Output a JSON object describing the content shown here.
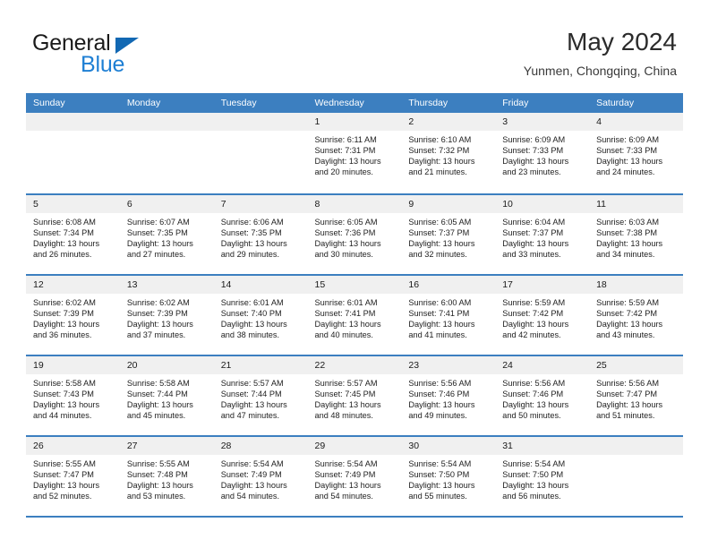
{
  "brand": {
    "name_part1": "General",
    "name_part2": "Blue",
    "triangle_color": "#1268b3",
    "blue_color": "#1e7fd4"
  },
  "header": {
    "month_title": "May 2024",
    "location": "Yunmen, Chongqing, China"
  },
  "theme": {
    "header_row_bg": "#3c7fc0",
    "header_row_text": "#ffffff",
    "day_band_bg": "#f0f0f0",
    "cell_bg": "#ffffff",
    "separator": "#3c7fc0"
  },
  "calendar": {
    "day_headers": [
      "Sunday",
      "Monday",
      "Tuesday",
      "Wednesday",
      "Thursday",
      "Friday",
      "Saturday"
    ],
    "weeks": [
      [
        {
          "empty": true
        },
        {
          "empty": true
        },
        {
          "empty": true
        },
        {
          "day": "1",
          "sunrise": "Sunrise: 6:11 AM",
          "sunset": "Sunset: 7:31 PM",
          "daylight_1": "Daylight: 13 hours",
          "daylight_2": "and 20 minutes."
        },
        {
          "day": "2",
          "sunrise": "Sunrise: 6:10 AM",
          "sunset": "Sunset: 7:32 PM",
          "daylight_1": "Daylight: 13 hours",
          "daylight_2": "and 21 minutes."
        },
        {
          "day": "3",
          "sunrise": "Sunrise: 6:09 AM",
          "sunset": "Sunset: 7:33 PM",
          "daylight_1": "Daylight: 13 hours",
          "daylight_2": "and 23 minutes."
        },
        {
          "day": "4",
          "sunrise": "Sunrise: 6:09 AM",
          "sunset": "Sunset: 7:33 PM",
          "daylight_1": "Daylight: 13 hours",
          "daylight_2": "and 24 minutes."
        }
      ],
      [
        {
          "day": "5",
          "sunrise": "Sunrise: 6:08 AM",
          "sunset": "Sunset: 7:34 PM",
          "daylight_1": "Daylight: 13 hours",
          "daylight_2": "and 26 minutes."
        },
        {
          "day": "6",
          "sunrise": "Sunrise: 6:07 AM",
          "sunset": "Sunset: 7:35 PM",
          "daylight_1": "Daylight: 13 hours",
          "daylight_2": "and 27 minutes."
        },
        {
          "day": "7",
          "sunrise": "Sunrise: 6:06 AM",
          "sunset": "Sunset: 7:35 PM",
          "daylight_1": "Daylight: 13 hours",
          "daylight_2": "and 29 minutes."
        },
        {
          "day": "8",
          "sunrise": "Sunrise: 6:05 AM",
          "sunset": "Sunset: 7:36 PM",
          "daylight_1": "Daylight: 13 hours",
          "daylight_2": "and 30 minutes."
        },
        {
          "day": "9",
          "sunrise": "Sunrise: 6:05 AM",
          "sunset": "Sunset: 7:37 PM",
          "daylight_1": "Daylight: 13 hours",
          "daylight_2": "and 32 minutes."
        },
        {
          "day": "10",
          "sunrise": "Sunrise: 6:04 AM",
          "sunset": "Sunset: 7:37 PM",
          "daylight_1": "Daylight: 13 hours",
          "daylight_2": "and 33 minutes."
        },
        {
          "day": "11",
          "sunrise": "Sunrise: 6:03 AM",
          "sunset": "Sunset: 7:38 PM",
          "daylight_1": "Daylight: 13 hours",
          "daylight_2": "and 34 minutes."
        }
      ],
      [
        {
          "day": "12",
          "sunrise": "Sunrise: 6:02 AM",
          "sunset": "Sunset: 7:39 PM",
          "daylight_1": "Daylight: 13 hours",
          "daylight_2": "and 36 minutes."
        },
        {
          "day": "13",
          "sunrise": "Sunrise: 6:02 AM",
          "sunset": "Sunset: 7:39 PM",
          "daylight_1": "Daylight: 13 hours",
          "daylight_2": "and 37 minutes."
        },
        {
          "day": "14",
          "sunrise": "Sunrise: 6:01 AM",
          "sunset": "Sunset: 7:40 PM",
          "daylight_1": "Daylight: 13 hours",
          "daylight_2": "and 38 minutes."
        },
        {
          "day": "15",
          "sunrise": "Sunrise: 6:01 AM",
          "sunset": "Sunset: 7:41 PM",
          "daylight_1": "Daylight: 13 hours",
          "daylight_2": "and 40 minutes."
        },
        {
          "day": "16",
          "sunrise": "Sunrise: 6:00 AM",
          "sunset": "Sunset: 7:41 PM",
          "daylight_1": "Daylight: 13 hours",
          "daylight_2": "and 41 minutes."
        },
        {
          "day": "17",
          "sunrise": "Sunrise: 5:59 AM",
          "sunset": "Sunset: 7:42 PM",
          "daylight_1": "Daylight: 13 hours",
          "daylight_2": "and 42 minutes."
        },
        {
          "day": "18",
          "sunrise": "Sunrise: 5:59 AM",
          "sunset": "Sunset: 7:42 PM",
          "daylight_1": "Daylight: 13 hours",
          "daylight_2": "and 43 minutes."
        }
      ],
      [
        {
          "day": "19",
          "sunrise": "Sunrise: 5:58 AM",
          "sunset": "Sunset: 7:43 PM",
          "daylight_1": "Daylight: 13 hours",
          "daylight_2": "and 44 minutes."
        },
        {
          "day": "20",
          "sunrise": "Sunrise: 5:58 AM",
          "sunset": "Sunset: 7:44 PM",
          "daylight_1": "Daylight: 13 hours",
          "daylight_2": "and 45 minutes."
        },
        {
          "day": "21",
          "sunrise": "Sunrise: 5:57 AM",
          "sunset": "Sunset: 7:44 PM",
          "daylight_1": "Daylight: 13 hours",
          "daylight_2": "and 47 minutes."
        },
        {
          "day": "22",
          "sunrise": "Sunrise: 5:57 AM",
          "sunset": "Sunset: 7:45 PM",
          "daylight_1": "Daylight: 13 hours",
          "daylight_2": "and 48 minutes."
        },
        {
          "day": "23",
          "sunrise": "Sunrise: 5:56 AM",
          "sunset": "Sunset: 7:46 PM",
          "daylight_1": "Daylight: 13 hours",
          "daylight_2": "and 49 minutes."
        },
        {
          "day": "24",
          "sunrise": "Sunrise: 5:56 AM",
          "sunset": "Sunset: 7:46 PM",
          "daylight_1": "Daylight: 13 hours",
          "daylight_2": "and 50 minutes."
        },
        {
          "day": "25",
          "sunrise": "Sunrise: 5:56 AM",
          "sunset": "Sunset: 7:47 PM",
          "daylight_1": "Daylight: 13 hours",
          "daylight_2": "and 51 minutes."
        }
      ],
      [
        {
          "day": "26",
          "sunrise": "Sunrise: 5:55 AM",
          "sunset": "Sunset: 7:47 PM",
          "daylight_1": "Daylight: 13 hours",
          "daylight_2": "and 52 minutes."
        },
        {
          "day": "27",
          "sunrise": "Sunrise: 5:55 AM",
          "sunset": "Sunset: 7:48 PM",
          "daylight_1": "Daylight: 13 hours",
          "daylight_2": "and 53 minutes."
        },
        {
          "day": "28",
          "sunrise": "Sunrise: 5:54 AM",
          "sunset": "Sunset: 7:49 PM",
          "daylight_1": "Daylight: 13 hours",
          "daylight_2": "and 54 minutes."
        },
        {
          "day": "29",
          "sunrise": "Sunrise: 5:54 AM",
          "sunset": "Sunset: 7:49 PM",
          "daylight_1": "Daylight: 13 hours",
          "daylight_2": "and 54 minutes."
        },
        {
          "day": "30",
          "sunrise": "Sunrise: 5:54 AM",
          "sunset": "Sunset: 7:50 PM",
          "daylight_1": "Daylight: 13 hours",
          "daylight_2": "and 55 minutes."
        },
        {
          "day": "31",
          "sunrise": "Sunrise: 5:54 AM",
          "sunset": "Sunset: 7:50 PM",
          "daylight_1": "Daylight: 13 hours",
          "daylight_2": "and 56 minutes."
        },
        {
          "empty": true
        }
      ]
    ]
  }
}
